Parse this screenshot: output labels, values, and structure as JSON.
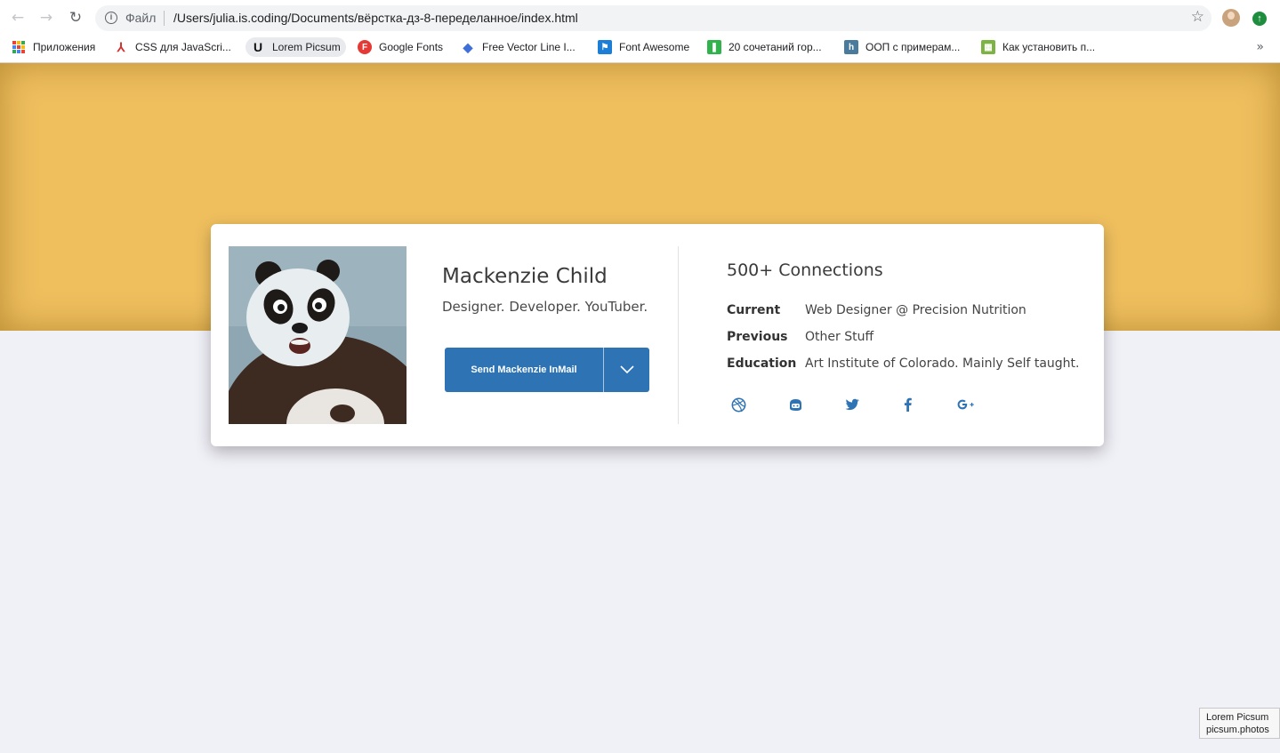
{
  "browser": {
    "scheme_label": "Файл",
    "url": "/Users/julia.is.coding/Documents/вёрстка-дз-8-переделанное/index.html",
    "bookmarks": [
      {
        "label": "Приложения",
        "icon": "apps-grid-icon"
      },
      {
        "label": "CSS для JavaScri...",
        "icon": "css-icon",
        "color": "#d32f2f"
      },
      {
        "label": "Lorem Picsum",
        "icon": "unsplash-icon",
        "color": "#111111"
      },
      {
        "label": "Google Fonts",
        "icon": "google-fonts-icon",
        "color": "#e53935"
      },
      {
        "label": "Free Vector Line I...",
        "icon": "diamond-icon",
        "color": "#3f6fd8"
      },
      {
        "label": "Font Awesome",
        "icon": "flag-icon",
        "color": "#1c7ed6"
      },
      {
        "label": "20 сочетаний гор...",
        "icon": "green-bookmark-icon",
        "color": "#2fb34a"
      },
      {
        "label": "ООП с примерам...",
        "icon": "h-icon",
        "color": "#4a7a9c"
      },
      {
        "label": "Как установить п...",
        "icon": "green-grid-icon",
        "color": "#7cb342"
      }
    ],
    "more_label": "»"
  },
  "profile": {
    "name": "Mackenzie Child",
    "tagline": "Designer. Developer. YouTuber.",
    "mail_button_label": "Send Mackenzie InMail",
    "connections": "500+ Connections",
    "info": [
      {
        "key": "Current",
        "value": "Web Designer @ Precision Nutrition"
      },
      {
        "key": "Previous",
        "value": "Other Stuff"
      },
      {
        "key": "Education",
        "value": "Art Institute of Colorado. Mainly Self taught."
      }
    ],
    "socials": [
      "dribbble-icon",
      "github-icon",
      "twitter-icon",
      "facebook-icon",
      "google-plus-icon"
    ],
    "accent_color": "#2e74b5",
    "hero_color": "#efbf5e"
  },
  "tooltip": {
    "line1": "Lorem Picsum",
    "line2": "picsum.photos"
  }
}
